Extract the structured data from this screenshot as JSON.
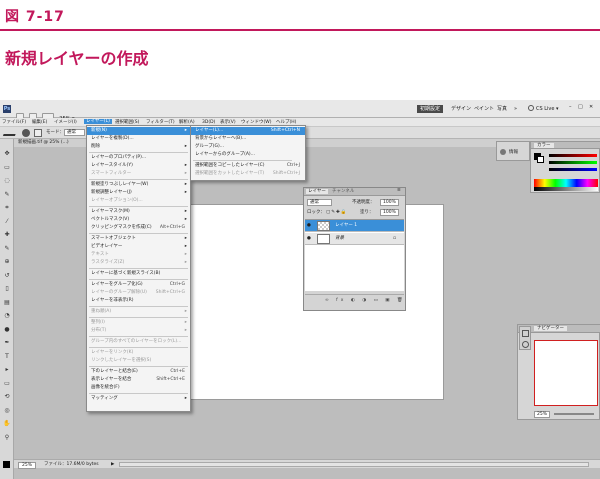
{
  "figure": {
    "label": "図 7-17",
    "title": "新規レイヤーの作成"
  },
  "app": {
    "workspace_buttons": [
      "初期設定",
      "デザイン",
      "ペイント",
      "写真",
      "»"
    ],
    "cs_live": "CS Live ▾",
    "zoom_top": "25% ▾"
  },
  "menubar": [
    "ファイル(F)",
    "編集(E)",
    "イメージ(I)",
    "レイヤー(L)",
    "選択範囲(S)",
    "フィルター(T)",
    "解析(A)",
    "3D(D)",
    "表示(V)",
    "ウィンドウ(W)",
    "ヘルプ(H)"
  ],
  "options": {
    "mode_label": "モード：",
    "mode_value": "通常"
  },
  "doc_tab": "新規描画.tif @ 25% (...)",
  "layer_menu": [
    {
      "label": "新規(N)",
      "arrow": true,
      "highlight": true
    },
    {
      "label": "レイヤーを複製(D)..."
    },
    {
      "label": "削除",
      "arrow": true
    },
    {
      "sep": true
    },
    {
      "label": "レイヤーのプロパティ(P)..."
    },
    {
      "label": "レイヤースタイル(Y)",
      "arrow": true
    },
    {
      "label": "スマートフィルター",
      "arrow": true,
      "disabled": true
    },
    {
      "sep": true
    },
    {
      "label": "新規塗りつぶしレイヤー(W)",
      "arrow": true
    },
    {
      "label": "新規調整レイヤー(J)",
      "arrow": true
    },
    {
      "label": "レイヤーオプション(O)...",
      "disabled": true
    },
    {
      "sep": true
    },
    {
      "label": "レイヤーマスク(M)",
      "arrow": true
    },
    {
      "label": "ベクトルマスク(V)",
      "arrow": true
    },
    {
      "label": "クリッピングマスクを作成(C)",
      "shortcut": "Alt+Ctrl+G"
    },
    {
      "sep": true
    },
    {
      "label": "スマートオブジェクト",
      "arrow": true
    },
    {
      "label": "ビデオレイヤー",
      "arrow": true
    },
    {
      "label": "テキスト",
      "arrow": true,
      "disabled": true
    },
    {
      "label": "ラスタライズ(Z)",
      "arrow": true,
      "disabled": true
    },
    {
      "sep": true
    },
    {
      "label": "レイヤーに基づく新規スライス(B)"
    },
    {
      "sep": true
    },
    {
      "label": "レイヤーをグループ化(G)",
      "shortcut": "Ctrl+G"
    },
    {
      "label": "レイヤーのグループ解除(U)",
      "shortcut": "Shift+Ctrl+G",
      "disabled": true
    },
    {
      "label": "レイヤーを非表示(R)"
    },
    {
      "sep": true
    },
    {
      "label": "重ね順(A)",
      "arrow": true,
      "disabled": true
    },
    {
      "sep": true
    },
    {
      "label": "整列(I)",
      "arrow": true,
      "disabled": true
    },
    {
      "label": "分布(T)",
      "arrow": true,
      "disabled": true
    },
    {
      "sep": true
    },
    {
      "label": "グループ内のすべてのレイヤーをロック(L)...",
      "disabled": true
    },
    {
      "sep": true
    },
    {
      "label": "レイヤーをリンク(K)",
      "disabled": true
    },
    {
      "label": "リンクしたレイヤーを選択(S)",
      "disabled": true
    },
    {
      "sep": true
    },
    {
      "label": "下のレイヤーと結合(E)",
      "shortcut": "Ctrl+E"
    },
    {
      "label": "表示レイヤーを結合",
      "shortcut": "Shift+Ctrl+E"
    },
    {
      "label": "画像を統合(F)"
    },
    {
      "sep": true
    },
    {
      "label": "マッティング",
      "arrow": true
    }
  ],
  "new_submenu": [
    {
      "label": "レイヤー(L)...",
      "shortcut": "Shift+Ctrl+N",
      "highlight": true
    },
    {
      "label": "背景からレイヤーへ(B)..."
    },
    {
      "label": "グループ(G)..."
    },
    {
      "label": "レイヤーからのグループ(A)..."
    },
    {
      "sep": true
    },
    {
      "label": "選択範囲をコピーしたレイヤー(C)",
      "shortcut": "Ctrl+J"
    },
    {
      "label": "選択範囲をカットしたレイヤー(T)",
      "shortcut": "Shift+Ctrl+J",
      "disabled": true
    }
  ],
  "layers_panel": {
    "tab_active": "レイヤー",
    "tab_other": "チャンネル",
    "blend_mode": "通常",
    "opacity_label": "不透明度：",
    "opacity_value": "100%",
    "lock_label": "ロック：",
    "fill_label": "塗り：",
    "fill_value": "100%",
    "layers": [
      {
        "name": "レイヤー 1",
        "selected": true
      },
      {
        "name": "背景",
        "selected": false
      }
    ]
  },
  "color_panel": {
    "title": "カラー"
  },
  "collapsed_panel": {
    "label": "情報"
  },
  "nav_panel": {
    "title": "ナビゲーター",
    "zoom": "25%"
  },
  "statusbar": {
    "zoom": "25%",
    "file_info": "ファイル：17.6M/0 bytes"
  },
  "colors": {
    "accent": "#c2185b",
    "menu_highlight": "#3a8fd8",
    "selected_layer": "#3a8fd8"
  }
}
